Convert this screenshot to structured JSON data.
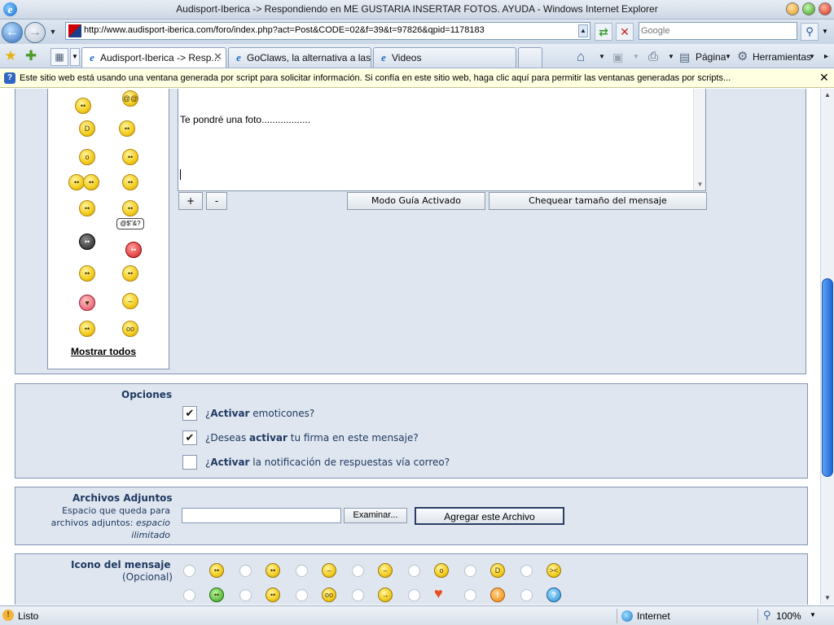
{
  "window": {
    "title": "Audisport-Iberica -> Respondiendo en ME GUSTARIA INSERTAR FOTOS. AYUDA - Windows Internet Explorer"
  },
  "addressbar": {
    "url": "http://www.audisport-iberica.com/foro/index.php?act=Post&CODE=02&f=39&t=97826&qpid=1178183",
    "search_placeholder": "Google"
  },
  "tabs": [
    {
      "label": "Audisport-Iberica -> Resp...",
      "active": true
    },
    {
      "label": "GoClaws, la alternativa a las ...",
      "active": false
    },
    {
      "label": "Videos",
      "active": false
    }
  ],
  "commandbar": {
    "page_label": "Página",
    "tools_label": "Herramientas"
  },
  "infobar": {
    "message": "Este sitio web está usando una ventana generada por script para solicitar información. Si confía en este sitio web, haga clic aquí para permitir las ventanas generadas por scripts..."
  },
  "editor": {
    "text": "Te pondré una foto..................",
    "plus_label": "+",
    "minus_label": "-",
    "guide_mode_label": "Modo Guía Activado",
    "check_size_label": "Chequear tamaño del mensaje"
  },
  "emoticons": {
    "show_all_label": "Mostrar todos",
    "speech_bubble_text": "@$\"&?"
  },
  "options": {
    "heading": "Opciones",
    "items": [
      {
        "prefix": "¿",
        "bold": "Activar",
        "suffix": " emoticones?",
        "checked": true
      },
      {
        "prefix": "¿Deseas ",
        "bold": "activar",
        "suffix": " tu firma en este mensaje?",
        "checked": true
      },
      {
        "prefix": "¿",
        "bold": "Activar",
        "suffix": " la notificación de respuestas vía correo?",
        "checked": false
      }
    ]
  },
  "attachments": {
    "heading": "Archivos Adjuntos",
    "desc_line1": "Espacio que queda para",
    "desc_line2": "archivos adjuntos:",
    "desc_italic1": "espacio",
    "desc_italic2": "ilimitado",
    "browse_label": "Examinar...",
    "add_label": "Agregar este Archivo"
  },
  "message_icon": {
    "heading": "Icono del mensaje",
    "subheading": "(Opcional)"
  },
  "statusbar": {
    "status": "Listo",
    "zone": "Internet",
    "zoom": "100%"
  },
  "colors": {
    "panel_bg": "#dfe6ef",
    "panel_border": "#8394b2",
    "label_text": "#203a63",
    "scroll_thumb": "#1c67d8"
  }
}
